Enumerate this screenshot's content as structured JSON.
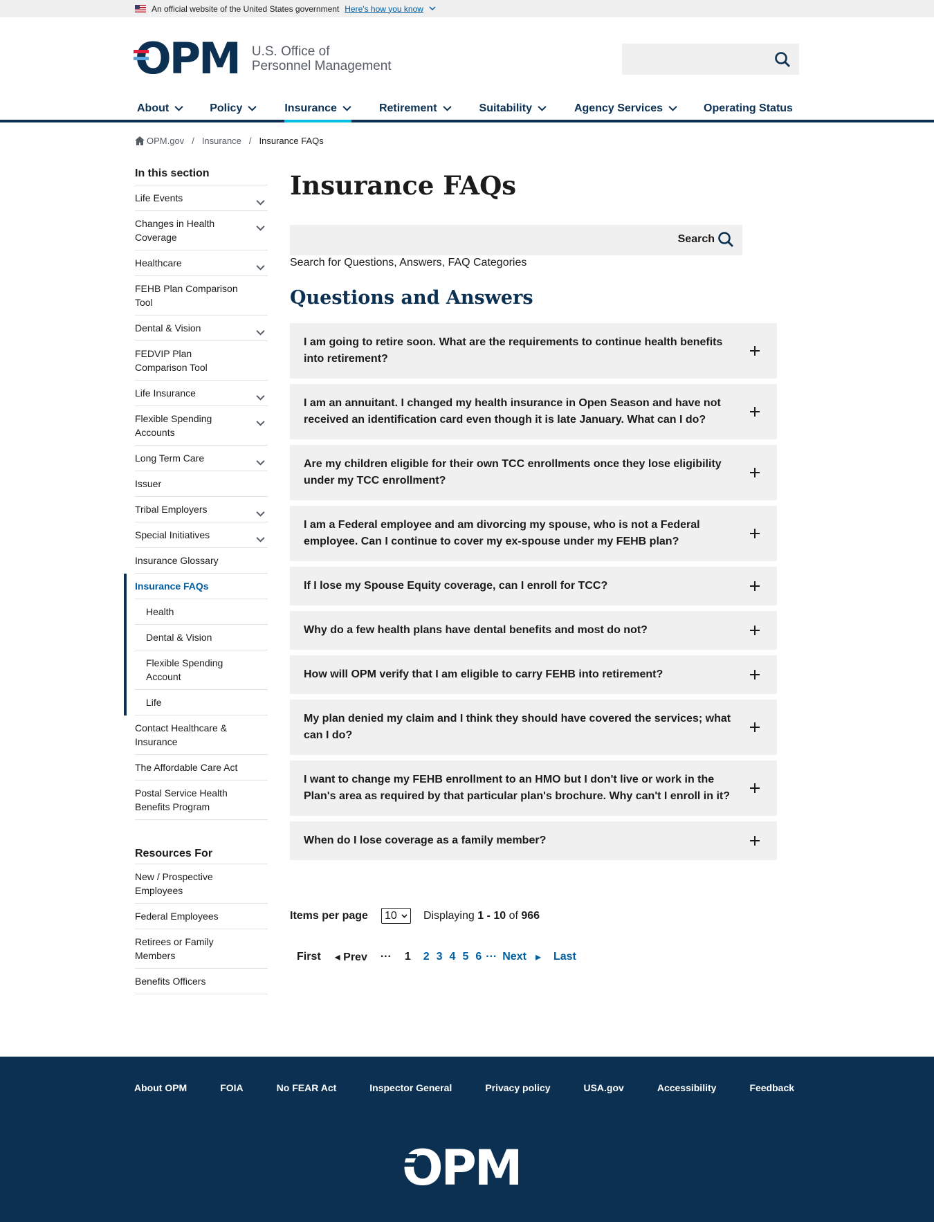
{
  "gov_banner": {
    "text": "An official website of the United States government",
    "link": "Here's how you know"
  },
  "header": {
    "logo_mark": "OPM",
    "logo_line1": "U.S. Office of",
    "logo_line2": "Personnel Management",
    "search_placeholder": ""
  },
  "nav": [
    {
      "label": "About",
      "has_menu": true
    },
    {
      "label": "Policy",
      "has_menu": true
    },
    {
      "label": "Insurance",
      "has_menu": true,
      "active": true
    },
    {
      "label": "Retirement",
      "has_menu": true
    },
    {
      "label": "Suitability",
      "has_menu": true
    },
    {
      "label": "Agency Services",
      "has_menu": true
    },
    {
      "label": "Operating Status",
      "has_menu": false
    }
  ],
  "breadcrumb": {
    "home": "OPM.gov",
    "level1": "Insurance",
    "current": "Insurance FAQs"
  },
  "sidebar": {
    "heading": "In this section",
    "items": [
      {
        "label": "Life Events",
        "expandable": true
      },
      {
        "label": "Changes in Health Coverage",
        "expandable": true
      },
      {
        "label": "Healthcare",
        "expandable": true
      },
      {
        "label": "FEHB Plan Comparison Tool",
        "expandable": false
      },
      {
        "label": "Dental & Vision",
        "expandable": true
      },
      {
        "label": "FEDVIP Plan Comparison Tool",
        "expandable": false
      },
      {
        "label": "Life Insurance",
        "expandable": true
      },
      {
        "label": "Flexible Spending Accounts",
        "expandable": true
      },
      {
        "label": "Long Term Care",
        "expandable": true
      },
      {
        "label": "Issuer",
        "expandable": false
      },
      {
        "label": "Tribal Employers",
        "expandable": true
      },
      {
        "label": "Special Initiatives",
        "expandable": true
      },
      {
        "label": "Insurance Glossary",
        "expandable": false
      }
    ],
    "active_item": "Insurance FAQs",
    "sub_items": [
      "Health",
      "Dental & Vision",
      "Flexible Spending Account",
      "Life"
    ],
    "after_items": [
      "Contact Healthcare & Insurance",
      "The Affordable Care Act",
      "Postal Service Health Benefits Program"
    ],
    "resources_heading": "Resources For",
    "resources": [
      "New / Prospective Employees",
      "Federal Employees",
      "Retirees or Family Members",
      "Benefits Officers"
    ]
  },
  "main": {
    "title": "Insurance FAQs",
    "search_button": "Search",
    "search_help": "Search for Questions, Answers, FAQ Categories",
    "qa_heading": "Questions and Answers",
    "questions": [
      "I am going to retire soon. What are the requirements to continue health benefits into retirement?",
      "I am an annuitant. I changed my health insurance in Open Season and have not received an identification card even though it is late January. What can I do?",
      "Are my children eligible for their own TCC enrollments once they lose eligibility under my TCC enrollment?",
      "I am a Federal employee and am divorcing my spouse, who is not a Federal employee. Can I continue to cover my ex-spouse under my FEHB plan?",
      "If I lose my Spouse Equity coverage, can I enroll for TCC?",
      "Why do a few health plans have dental benefits and most do not?",
      "How will OPM verify that I am eligible to carry FEHB into retirement?",
      "My plan denied my claim and I think they should have covered the services; what can I do?",
      "I want to change my FEHB enrollment to an HMO but I don't live or work in the Plan's area as required by that particular plan's brochure. Why can't I enroll in it?",
      "When do I lose coverage as a family member?"
    ],
    "items_per_page_label": "Items per page",
    "items_per_page_value": "10",
    "displaying_label": "Displaying",
    "displaying_range": "1 - 10",
    "displaying_of": "of",
    "displaying_total": "966",
    "pager": {
      "first": "First",
      "prev": "◂ Prev",
      "ellipsis": "···",
      "current": "1",
      "pages": [
        "2",
        "3",
        "4",
        "5",
        "6"
      ],
      "next": "Next",
      "next_arrow": "▸",
      "last": "Last"
    }
  },
  "footer": {
    "links": [
      "About OPM",
      "FOIA",
      "No FEAR Act",
      "Inspector General",
      "Privacy policy",
      "USA.gov",
      "Accessibility",
      "Feedback"
    ],
    "logo_mark": "OPM"
  }
}
